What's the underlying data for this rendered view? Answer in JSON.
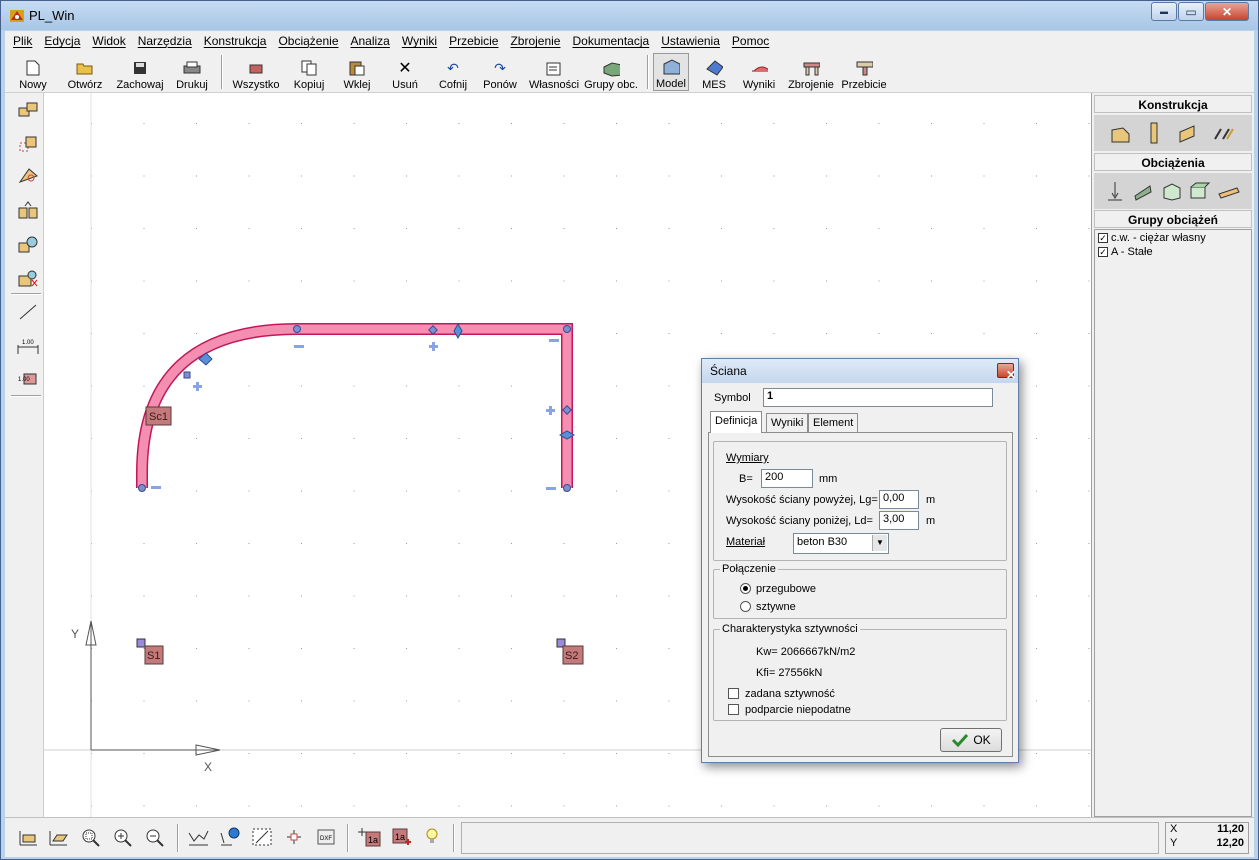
{
  "window": {
    "title": "PL_Win",
    "min": "▬",
    "max": "▭",
    "close": "✕"
  },
  "menu": [
    "Plik",
    "Edycja",
    "Widok",
    "Narzędzia",
    "Konstrukcja",
    "Obciążenie",
    "Analiza",
    "Wyniki",
    "Przebicie",
    "Zbrojenie",
    "Dokumentacja",
    "Ustawienia",
    "Pomoc"
  ],
  "toolbar": {
    "nowy": "Nowy",
    "otworz": "Otwórz",
    "zachowaj": "Zachowaj",
    "drukuj": "Drukuj",
    "wszystko": "Wszystko",
    "kopiuj": "Kopiuj",
    "wklej": "Wklej",
    "usun": "Usuń",
    "cofnij": "Cofnij",
    "ponow": "Ponów",
    "wlasnosci": "Własności",
    "grupy": "Grupy obc.",
    "model": "Model",
    "mes": "MES",
    "wyniki": "Wyniki",
    "zbrojenie": "Zbrojenie",
    "przebicie": "Przebicie"
  },
  "canvas": {
    "wall_label": "Sc1",
    "support1": "S1",
    "support2": "S2",
    "axis_y": "Y",
    "axis_x": "X"
  },
  "right_panel": {
    "konstrukcja": "Konstrukcja",
    "obciazenia": "Obciążenia",
    "grupy": "Grupy obciążeń",
    "groups": [
      {
        "label": "c.w. - ciężar własny",
        "checked": true
      },
      {
        "label": "A - Stałe",
        "checked": true
      }
    ]
  },
  "status": {
    "x_label": "X",
    "x_value": "11,20",
    "y_label": "Y",
    "y_value": "12,20"
  },
  "dialog": {
    "title": "Ściana",
    "symbol_label": "Symbol",
    "symbol_value": "1",
    "tabs": [
      "Definicja",
      "Wyniki",
      "Element"
    ],
    "wymiary": "Wymiary",
    "b_label": "B=",
    "b_value": "200",
    "b_unit": "mm",
    "lg_label": "Wysokość ściany powyżej, Lg=",
    "lg_value": "0,00",
    "lg_unit": "m",
    "ld_label": "Wysokość ściany poniżej, Ld=",
    "ld_value": "3,00",
    "ld_unit": "m",
    "material_label": "Materiał",
    "material_value": "beton B30",
    "polaczenie": "Połączenie",
    "przegubowe": "przegubowe",
    "sztywne": "sztywne",
    "char": "Charakterystyka sztywności",
    "kw": "Kw= 2066667kN/m2",
    "kfi": "Kfi=  27556kN",
    "zadana": "zadana sztywność",
    "podparcie": "podparcie niepodatne",
    "ok": "OK"
  }
}
